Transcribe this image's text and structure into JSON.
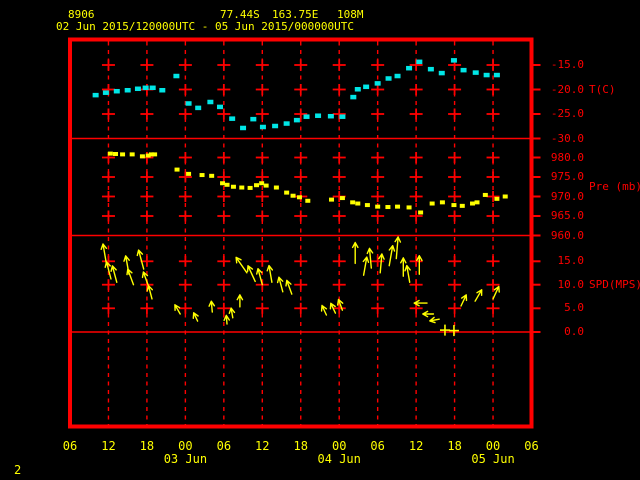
{
  "header": {
    "station_id": "8906",
    "latitude": "77.44S",
    "longitude": "163.75E",
    "elevation": "108M",
    "period": "02 Jun 2015/120000UTC - 05 Jun 2015/000000UTC"
  },
  "corner_label": "2",
  "colors": {
    "background": "#000000",
    "grid": "#ff0000",
    "border": "#ff0000",
    "axis_text": "#ff0000",
    "time_text": "#ffff00",
    "temperature_series": "#00e6e6",
    "pressure_series": "#ffff00",
    "wind_series": "#ffff00"
  },
  "value_axis": {
    "temperature": {
      "unit": "T(C)",
      "ticks": [
        "-15.0",
        "-20.0",
        "-25.0",
        "-30.0"
      ]
    },
    "pressure": {
      "unit": "Pre (mb)",
      "ticks": [
        "980.0",
        "975.0",
        "970.0",
        "965.0",
        "960.0"
      ]
    },
    "wind": {
      "unit": "SPD(MPS)",
      "ticks": [
        "15.0",
        "10.0",
        "5.0",
        "0.0"
      ]
    }
  },
  "time_axis": {
    "hour_labels": [
      "06",
      "12",
      "18",
      "00",
      "06",
      "12",
      "18",
      "00",
      "06",
      "12",
      "18",
      "00",
      "06"
    ],
    "day_labels": [
      "03 Jun",
      "04 Jun",
      "05 Jun"
    ],
    "day_label_hours": [
      24,
      48,
      72
    ]
  },
  "chart_data": [
    {
      "type": "scatter",
      "name": "Temperature",
      "ylabel": "T(C)",
      "color": "#00e6e6",
      "x_unit": "hours since 2015-06-02 00:00 UTC",
      "xlim": [
        6,
        78
      ],
      "ylim": [
        -30,
        -10
      ],
      "points": [
        [
          10.0,
          -21.1
        ],
        [
          11.6,
          -20.6
        ],
        [
          13.3,
          -20.3
        ],
        [
          15.0,
          -20.1
        ],
        [
          16.6,
          -19.8
        ],
        [
          17.8,
          -19.6
        ],
        [
          18.9,
          -19.6
        ],
        [
          20.4,
          -20.1
        ],
        [
          22.6,
          -17.2
        ],
        [
          24.5,
          -22.8
        ],
        [
          26.0,
          -23.7
        ],
        [
          27.9,
          -22.5
        ],
        [
          29.4,
          -23.5
        ],
        [
          31.3,
          -25.9
        ],
        [
          33.0,
          -27.8
        ],
        [
          34.6,
          -26.0
        ],
        [
          36.1,
          -27.6
        ],
        [
          38.0,
          -27.4
        ],
        [
          39.8,
          -26.9
        ],
        [
          41.4,
          -26.2
        ],
        [
          42.9,
          -25.5
        ],
        [
          44.7,
          -25.3
        ],
        [
          46.7,
          -25.4
        ],
        [
          48.5,
          -25.5
        ],
        [
          50.2,
          -21.5
        ],
        [
          50.9,
          -19.9
        ],
        [
          52.2,
          -19.4
        ],
        [
          54.0,
          -18.7
        ],
        [
          55.7,
          -17.7
        ],
        [
          57.1,
          -17.2
        ],
        [
          58.9,
          -15.6
        ],
        [
          60.5,
          -14.3
        ],
        [
          62.3,
          -15.8
        ],
        [
          64.0,
          -16.6
        ],
        [
          65.9,
          -14.0
        ],
        [
          67.4,
          -16.0
        ],
        [
          69.3,
          -16.5
        ],
        [
          71.0,
          -17.0
        ],
        [
          72.6,
          -17.0
        ]
      ]
    },
    {
      "type": "scatter",
      "name": "Pressure",
      "ylabel": "Pre (mb)",
      "color": "#ffff00",
      "x_unit": "hours since 2015-06-02 00:00 UTC",
      "xlim": [
        6,
        78
      ],
      "ylim": [
        960,
        985
      ],
      "points": [
        [
          12.3,
          981.0
        ],
        [
          13.1,
          980.9
        ],
        [
          14.2,
          980.8
        ],
        [
          15.7,
          980.8
        ],
        [
          17.3,
          980.3
        ],
        [
          18.2,
          980.5
        ],
        [
          18.7,
          980.8
        ],
        [
          19.2,
          980.8
        ],
        [
          22.7,
          976.9
        ],
        [
          24.5,
          975.8
        ],
        [
          26.6,
          975.5
        ],
        [
          28.1,
          975.3
        ],
        [
          29.8,
          973.4
        ],
        [
          30.5,
          973.0
        ],
        [
          31.5,
          972.5
        ],
        [
          32.8,
          972.3
        ],
        [
          34.1,
          972.2
        ],
        [
          35.1,
          972.9
        ],
        [
          35.9,
          973.4
        ],
        [
          36.6,
          972.8
        ],
        [
          38.2,
          972.3
        ],
        [
          39.8,
          971.0
        ],
        [
          40.8,
          970.2
        ],
        [
          41.8,
          969.8
        ],
        [
          43.1,
          968.9
        ],
        [
          46.8,
          969.2
        ],
        [
          48.5,
          969.6
        ],
        [
          50.1,
          968.5
        ],
        [
          50.9,
          968.2
        ],
        [
          52.4,
          967.8
        ],
        [
          54.0,
          967.4
        ],
        [
          55.6,
          967.3
        ],
        [
          57.1,
          967.4
        ],
        [
          58.9,
          967.2
        ],
        [
          60.7,
          965.9
        ],
        [
          62.5,
          968.2
        ],
        [
          64.1,
          968.5
        ],
        [
          65.9,
          967.8
        ],
        [
          67.2,
          967.6
        ],
        [
          68.8,
          968.2
        ],
        [
          69.5,
          968.5
        ],
        [
          70.8,
          970.4
        ],
        [
          72.6,
          969.4
        ],
        [
          73.9,
          970.0
        ]
      ]
    },
    {
      "type": "wind_vectors",
      "name": "Wind",
      "ylabel": "SPD(MPS)",
      "color": "#ffff00",
      "x_unit": "hours since 2015-06-02 00:00 UTC",
      "xlim": [
        6,
        78
      ],
      "ylim": [
        0,
        20
      ],
      "dir_convention": "degrees clockwise from straight up; arrow drawn from the speed value toward that direction",
      "points": [
        [
          11.7,
          14.3,
          -10
        ],
        [
          12.4,
          11.2,
          -15
        ],
        [
          13.3,
          10.5,
          -15
        ],
        [
          15.2,
          12.2,
          -10
        ],
        [
          15.9,
          10.0,
          -20
        ],
        [
          17.5,
          13.3,
          -15
        ],
        [
          18.3,
          9.5,
          -20
        ],
        [
          18.8,
          7.0,
          -15
        ],
        [
          23.2,
          3.8,
          -30
        ],
        [
          25.9,
          2.3,
          -25
        ],
        [
          28.2,
          4.2,
          -5
        ],
        [
          30.5,
          1.7,
          -5
        ],
        [
          31.4,
          3.0,
          -10
        ],
        [
          32.5,
          5.3,
          0
        ],
        [
          33.6,
          12.5,
          -35
        ],
        [
          34.9,
          10.7,
          -25
        ],
        [
          36.0,
          10.0,
          -15
        ],
        [
          37.5,
          10.5,
          -10
        ],
        [
          39.2,
          8.5,
          -15
        ],
        [
          40.6,
          8.0,
          -20
        ],
        [
          46.0,
          3.6,
          -25
        ],
        [
          47.4,
          4.0,
          -25
        ],
        [
          48.5,
          4.6,
          -20
        ],
        [
          50.5,
          14.5,
          0
        ],
        [
          51.8,
          12.0,
          10
        ],
        [
          53.0,
          13.5,
          -5
        ],
        [
          54.4,
          12.5,
          5
        ],
        [
          55.8,
          14.0,
          10
        ],
        [
          56.9,
          15.5,
          5
        ],
        [
          58.0,
          11.8,
          0
        ],
        [
          59.0,
          10.5,
          -10
        ],
        [
          60.5,
          12.2,
          0
        ],
        [
          61.7,
          6.1,
          -90
        ],
        [
          62.7,
          3.8,
          -90
        ],
        [
          63.6,
          2.7,
          -100
        ],
        [
          67.0,
          5.5,
          25
        ],
        [
          69.2,
          6.5,
          30
        ],
        [
          72.0,
          7.0,
          25
        ]
      ],
      "calm_points": [
        [
          64.5,
          0.4
        ],
        [
          65.9,
          0.3
        ]
      ]
    }
  ]
}
